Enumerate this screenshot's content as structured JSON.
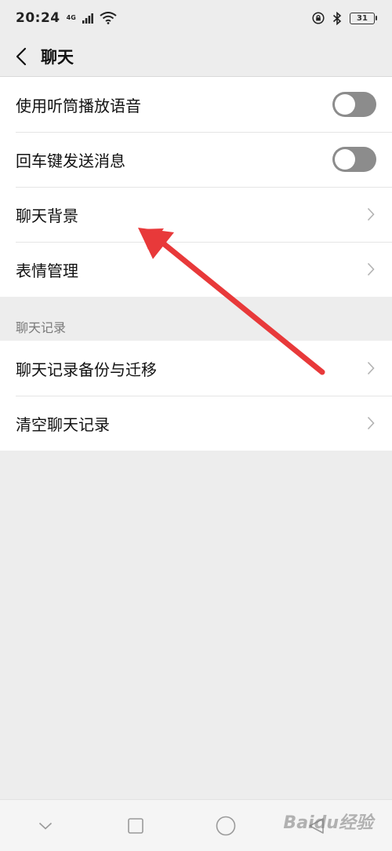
{
  "status_bar": {
    "time": "20:24",
    "network": "4G",
    "battery": "31"
  },
  "header": {
    "title": "聊天"
  },
  "settings": {
    "group1": [
      {
        "label": "使用听筒播放语音",
        "type": "toggle",
        "on": false
      },
      {
        "label": "回车键发送消息",
        "type": "toggle",
        "on": false
      },
      {
        "label": "聊天背景",
        "type": "link"
      },
      {
        "label": "表情管理",
        "type": "link"
      }
    ],
    "section_header": "聊天记录",
    "group2": [
      {
        "label": "聊天记录备份与迁移",
        "type": "link"
      },
      {
        "label": "清空聊天记录",
        "type": "link"
      }
    ]
  },
  "watermark": "Baidu经验",
  "colors": {
    "background": "#ededed",
    "toggle_off": "#8c8c8c",
    "annotation_arrow": "#e8393a"
  }
}
